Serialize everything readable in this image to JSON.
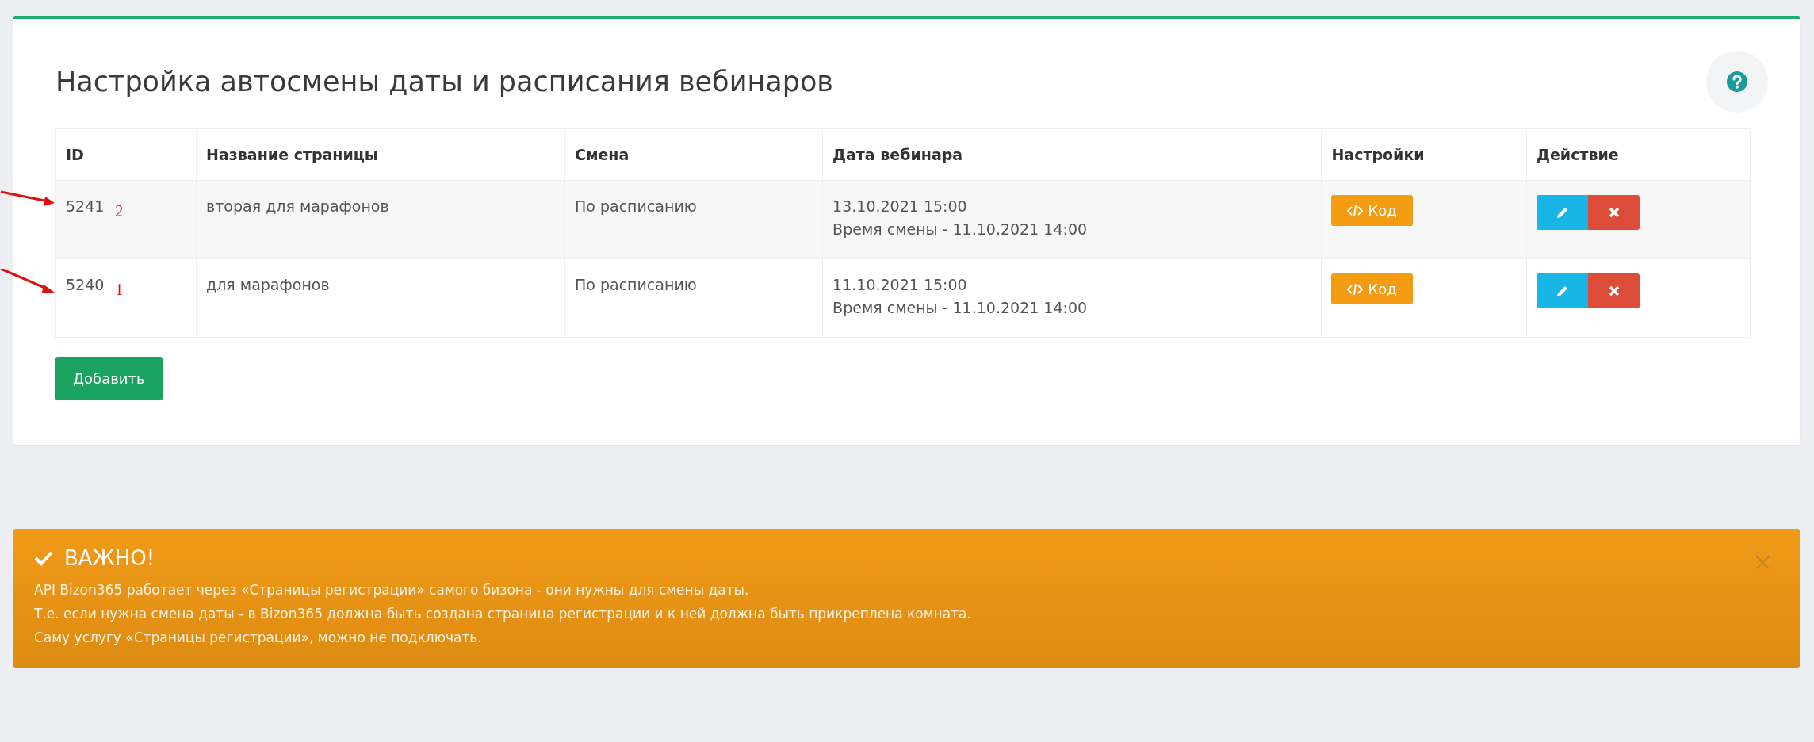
{
  "panel": {
    "title": "Настройка автосмены даты и расписания вебинаров"
  },
  "table": {
    "columns": [
      "ID",
      "Название страницы",
      "Смена",
      "Дата вебинара",
      "Настройки",
      "Действие"
    ],
    "rows": [
      {
        "id": "5241",
        "annotation": "2",
        "name": "вторая для марафонов",
        "mode": "По расписанию",
        "date": "13.10.2021 15:00",
        "change_time": "Время смены - 11.10.2021 14:00",
        "code_button": "Код"
      },
      {
        "id": "5240",
        "annotation": "1",
        "name": "для марафонов",
        "mode": "По расписанию",
        "date": "11.10.2021 15:00",
        "change_time": "Время смены - 11.10.2021 14:00",
        "code_button": "Код"
      }
    ]
  },
  "add_button": "Добавить",
  "alert": {
    "title": "ВАЖНО!",
    "close": "×",
    "lines": [
      "API Bizon365 работает через «Страницы регистрации» самого бизона - они нужны для смены даты.",
      "Т.е. если нужна смена даты - в Bizon365 должна быть создана страница регистрации и к ней должна быть прикреплена комната.",
      "Саму услугу «Страницы регистрации», можно не подключать."
    ]
  }
}
